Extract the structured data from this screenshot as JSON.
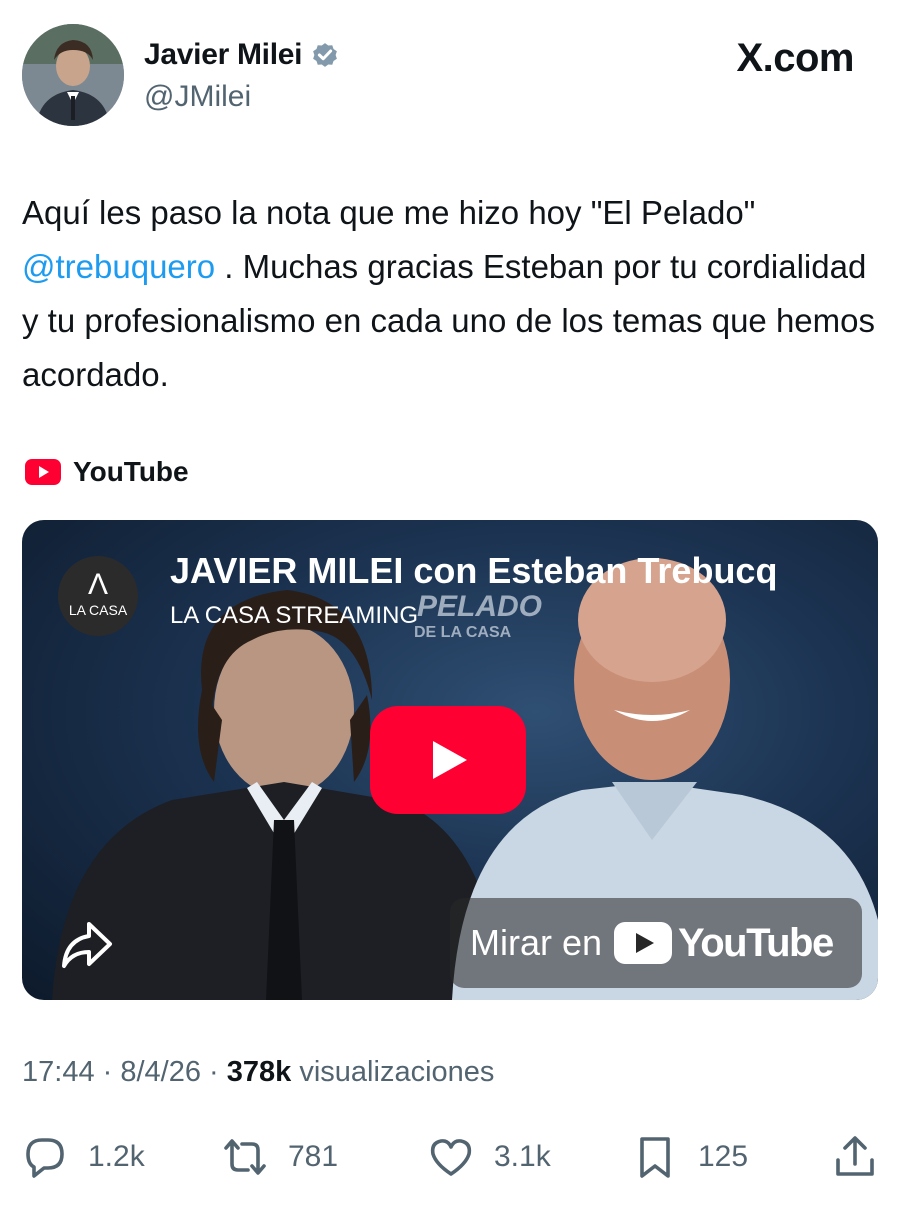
{
  "header": {
    "name": "Javier Milei",
    "handle": "@JMilei",
    "site": "X.com"
  },
  "tweet": {
    "text_before": "Aquí les paso la nota que me hizo hoy \"El Pelado\" ",
    "mention": "@trebuquero",
    "text_after": " . Muchas gracias Esteban por tu cordialidad y tu profesionalismo en cada uno de los temas que hemos acordado."
  },
  "card": {
    "source": "YouTube",
    "video_title": "JAVIER MILEI con Esteban Trebucq",
    "channel": "LA CASA STREAMING",
    "channel_logo_text": "LA CASA",
    "thumbnail_brand": "PELADO",
    "thumbnail_brand_sub": "DE LA CASA",
    "watch_label": "Mirar en",
    "watch_brand": "YouTube"
  },
  "meta": {
    "time": "17:44",
    "date": "8/4/26",
    "views": "378k",
    "views_label": "visualizaciones"
  },
  "actions": {
    "replies": "1.2k",
    "reposts": "781",
    "likes": "3.1k",
    "bookmarks": "125"
  },
  "colors": {
    "link": "#1d9bf0",
    "youtube_red": "#ff0033",
    "secondary_text": "#536471",
    "verified_badge": "#829aab"
  },
  "icons": [
    "verified-icon",
    "youtube-logo-icon",
    "play-icon",
    "share-icon",
    "reply-icon",
    "repost-icon",
    "like-icon",
    "bookmark-icon",
    "share-tweet-icon"
  ]
}
